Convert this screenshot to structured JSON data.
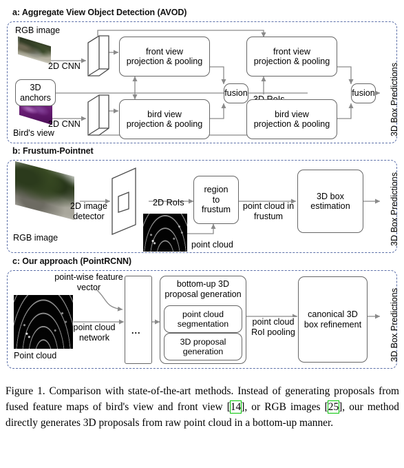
{
  "figure": {
    "caption_parts": [
      "Figure 1. Comparison with state-of-the-art methods. Instead of generating proposals from fused feature maps of bird's view and front view [",
      "14",
      "], or RGB images [",
      "25",
      "], our method directly generates 3D proposals from raw point cloud in a bottom-up manner."
    ],
    "caption_full": "Figure 1. Comparison with state-of-the-art methods. Instead of generating proposals from fused feature maps of bird's view and front view [14], or RGB images [25], our method directly generates 3D proposals from raw point cloud in a bottom-up manner.",
    "ref_color": "#00c400",
    "panel_border_color": "#5b6fa8",
    "box_border_color": "#666666"
  },
  "panel_a": {
    "heading": "a: Aggregate View Object Detection (AVOD)",
    "rgb_image_label": "RGB image",
    "birds_view_label": "Bird's view",
    "cnn_top_label": "2D CNN",
    "cnn_bottom_label": "2D CNN",
    "anchors_line1": "3D",
    "anchors_line2": "anchors",
    "front_view_1_line1": "front view",
    "front_view_1_line2": "projection & pooling",
    "bird_view_1_line1": "bird view",
    "bird_view_1_line2": "projection & pooling",
    "fusion_1": "fusion",
    "rois_label": "3D RoIs",
    "front_view_2_line1": "front view",
    "front_view_2_line2": "projection & pooling",
    "bird_view_2_line1": "bird view",
    "bird_view_2_line2": "projection & pooling",
    "fusion_2": "fusion",
    "output_label": "3D Box Predictions"
  },
  "panel_b": {
    "heading": "b: Frustum-Pointnet",
    "rgb_image_label": "RGB image",
    "detector_line1": "2D image",
    "detector_line2": "detector",
    "rois_label": "2D RoIs",
    "point_cloud_label": "point cloud",
    "frustum_line1": "region",
    "frustum_line2": "to",
    "frustum_line3": "frustum",
    "pc_in_frustum_line1": "point cloud",
    "pc_in_frustum_line2": "in frustum",
    "box_est_line1": "3D box",
    "box_est_line2": "estimation",
    "output_label": "3D Box Predictions"
  },
  "panel_c": {
    "heading": "c: Our approach (PointRCNN)",
    "point_cloud_label": "Point cloud",
    "feature_vector_line1": "point-wise",
    "feature_vector_line2": "feature vector",
    "network_line1": "point cloud",
    "network_line2": "network",
    "stack_ellipsis": "...",
    "bottomup_line1": "bottom-up 3D",
    "bottomup_line2": "proposal generation",
    "seg_line1": "point cloud",
    "seg_line2": "segmentation",
    "prop_line1": "3D proposal",
    "prop_line2": "generation",
    "pooling_line1": "point cloud",
    "pooling_line2": "RoI pooling",
    "refine_line1": "canonical 3D",
    "refine_line2": "box refinement",
    "output_label": "3D Box Predictions"
  }
}
